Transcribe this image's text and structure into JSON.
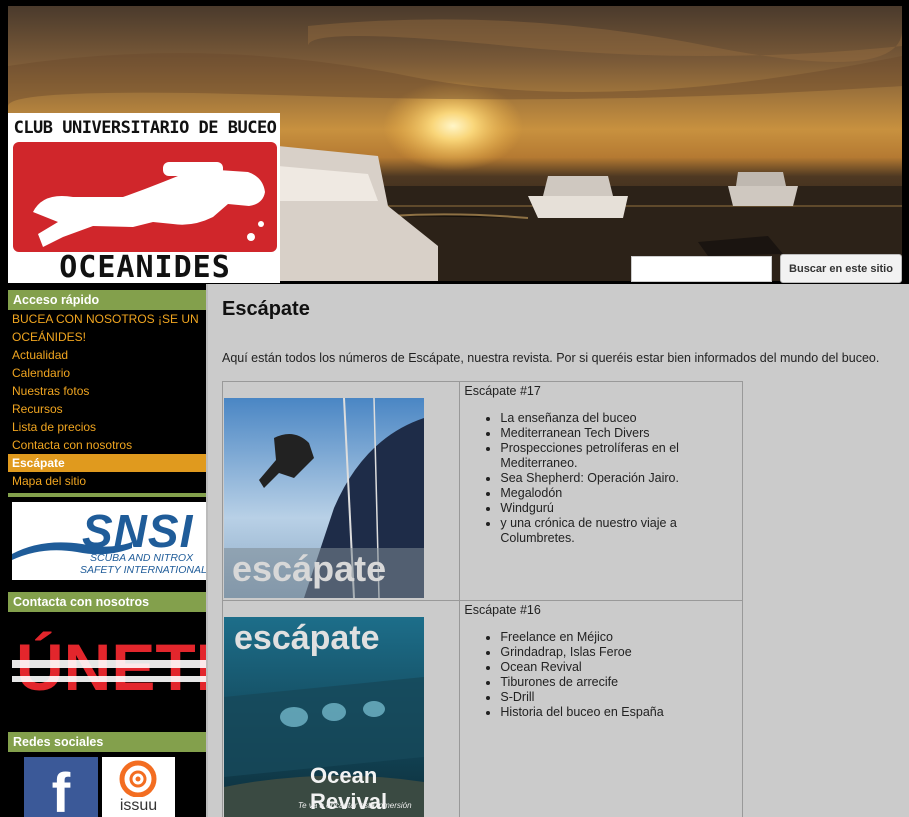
{
  "header": {
    "logo_top": "CLUB UNIVERSITARIO DE BUCEO",
    "logo_bottom": "OCEANIDES",
    "search_placeholder": "",
    "search_button": "Buscar en este sitio"
  },
  "sidebar": {
    "quick_access_title": "Acceso rápido",
    "items": [
      {
        "label": "BUCEA CON NOSOTROS ¡SE UN OCEÁNIDES!"
      },
      {
        "label": "Actualidad"
      },
      {
        "label": "Calendario"
      },
      {
        "label": "Nuestras fotos"
      },
      {
        "label": "Recursos"
      },
      {
        "label": "Lista de precios"
      },
      {
        "label": "Contacta con nosotros"
      },
      {
        "label": "Escápate",
        "active": true
      },
      {
        "label": "Mapa del sitio"
      }
    ],
    "snsi": {
      "word": "SNSI",
      "line1": "SCUBA AND NITROX",
      "line2": "SAFETY INTERNATIONAL"
    },
    "contact_title": "Contacta con nosotros",
    "unete_text": "ÚNETE",
    "social_title": "Redes sociales",
    "facebook_glyph": "f",
    "issuu_label": "issuu"
  },
  "main": {
    "title": "Escápate",
    "intro": "Aquí están todos los números de Escápate, nuestra revista. Por si queréis estar bien informados del mundo del buceo.",
    "issues": [
      {
        "title": "Escápate #17",
        "cover_word": "escápate",
        "items": [
          "La enseñanza del buceo",
          "Mediterranean Tech Divers",
          "Prospecciones petrolíferas en el Mediterraneo.",
          "Sea Shepherd: Operación Jairo.",
          "Megalodón",
          "Windgurú",
          "y una crónica de nuestro viaje a Columbretes."
        ]
      },
      {
        "title": "Escápate #16",
        "cover_word": "escápate",
        "cover_headline": "Ocean Revival",
        "cover_tagline": "Te va a encantar esta inmersión",
        "items": [
          "Freelance en Méjico",
          "Grindadrap, Islas Feroe",
          "Ocean Revival",
          "Tiburones de arrecife",
          "S-Drill",
          "Historia del buceo en España"
        ]
      }
    ]
  },
  "colors": {
    "sidebar_header": "#83a04c",
    "link": "#f0a520",
    "active_link_bg": "#e09a1e",
    "main_bg": "#cbcbcb"
  }
}
